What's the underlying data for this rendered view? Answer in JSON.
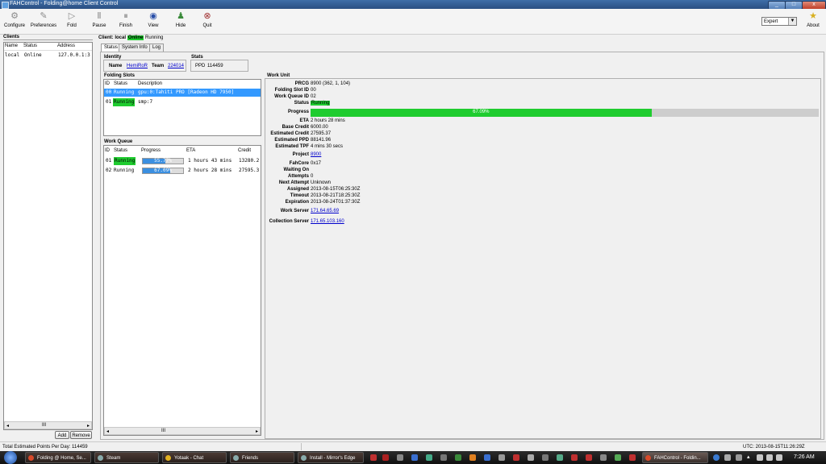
{
  "window": {
    "title": "FAHControl - Folding@home Client Control",
    "btn_min": "_",
    "btn_max": "□",
    "btn_close": "x"
  },
  "toolbar": {
    "items": [
      {
        "label": "Configure",
        "icon": "⚙"
      },
      {
        "label": "Preferences",
        "icon": "✎"
      },
      {
        "label": "Fold",
        "icon": "▷"
      },
      {
        "label": "Pause",
        "icon": "Ⅱ"
      },
      {
        "label": "Finish",
        "icon": "⏸"
      },
      {
        "label": "View",
        "icon": "◉"
      },
      {
        "label": "Hide",
        "icon": "♟"
      },
      {
        "label": "Quit",
        "icon": "⊗"
      }
    ],
    "mode": "Expert",
    "about": "About",
    "about_icon": "★"
  },
  "clients": {
    "group": "Clients",
    "headers": [
      "Name",
      "Status",
      "Address"
    ],
    "rows": [
      {
        "name": "local",
        "status": "Online",
        "address": "127.0.0.1:3"
      }
    ],
    "hscroll_mark": "III",
    "add": "Add",
    "remove": "Remove"
  },
  "client_header": {
    "prefix": "Client: local",
    "status": "Online",
    "state": "Running"
  },
  "tabs": [
    "Status",
    "System Info",
    "Log"
  ],
  "identity": {
    "group": "Identity",
    "name_label": "Name",
    "name": "HemiRoR",
    "team_label": "Team",
    "team": "224014"
  },
  "stats": {
    "group": "Stats",
    "ppd_label": "PPD",
    "ppd": "114459"
  },
  "slots": {
    "group": "Folding Slots",
    "headers": [
      "ID",
      "Status",
      "Description"
    ],
    "rows": [
      {
        "id": "00",
        "status": "Running",
        "desc": "gpu:0:Tahiti PRO [Radeon HD 7950]"
      },
      {
        "id": "01",
        "status": "Running",
        "desc": "smp:7"
      }
    ]
  },
  "queue": {
    "group": "Work Queue",
    "headers": [
      "ID",
      "Status",
      "Progress",
      "ETA",
      "Credit"
    ],
    "rows": [
      {
        "id": "01",
        "status": "Running",
        "progress": "55.77%",
        "progress_value": 0.5577,
        "eta": "1 hours 43 mins",
        "credit": "13280.2"
      },
      {
        "id": "02",
        "status": "Running",
        "progress": "67.09%",
        "progress_value": 0.6709,
        "eta": "2 hours 28 mins",
        "credit": "27595.3"
      }
    ],
    "hscroll_mark": "III"
  },
  "work_unit": {
    "group": "Work Unit",
    "prcg_label": "PRCG",
    "prcg": "8900 (362, 1, 104)",
    "slot_label": "Folding Slot ID",
    "slot": "00",
    "queue_label": "Work Queue ID",
    "queue": "02",
    "status_label": "Status",
    "status": "Running",
    "progress_label": "Progress",
    "progress": "67.09%",
    "progress_value": 0.6709,
    "eta_label": "ETA",
    "eta": "2 hours 28 mins",
    "base_label": "Base Credit",
    "base": "6000.00",
    "est_credit_label": "Estimated Credit",
    "est_credit": "27595.37",
    "est_ppd_label": "Estimated PPD",
    "est_ppd": "88141.96",
    "est_tpf_label": "Estimated TPF",
    "est_tpf": "4 mins 30 secs",
    "project_label": "Project",
    "project": "8900",
    "core_label": "FahCore",
    "core": "0x17",
    "waiting_label": "Waiting On",
    "waiting": "",
    "attempts_label": "Attempts",
    "attempts": "0",
    "next_label": "Next Attempt",
    "next": "Unknown",
    "assigned_label": "Assigned",
    "assigned": "2013-08-15T06:25:30Z",
    "timeout_label": "Timeout",
    "timeout": "2013-08-21T18:25:30Z",
    "expiration_label": "Expiration",
    "expiration": "2013-08-24T01:37:30Z",
    "ws_label": "Work Server",
    "ws": "171.64.65.69",
    "cs_label": "Collection Server",
    "cs": "171.65.103.160"
  },
  "statusbar": {
    "left": "Total Estimated Points Per Day: 114459",
    "right": "UTC: 2013-08-15T11:26:29Z"
  },
  "taskbar": {
    "tasks": [
      {
        "label": "Folding @ Home, Se...",
        "color": "#d84a2a"
      },
      {
        "label": "Steam",
        "color": "#8aa"
      },
      {
        "label": "Yotaak - Chat",
        "color": "#e0b020"
      },
      {
        "label": "Friends",
        "color": "#8aa"
      },
      {
        "label": "Install - Mirror's Edge",
        "color": "#8aa"
      },
      {
        "label": "FAHControl - Foldin...",
        "color": "#d84a2a"
      }
    ],
    "clock": "7:26 AM"
  }
}
